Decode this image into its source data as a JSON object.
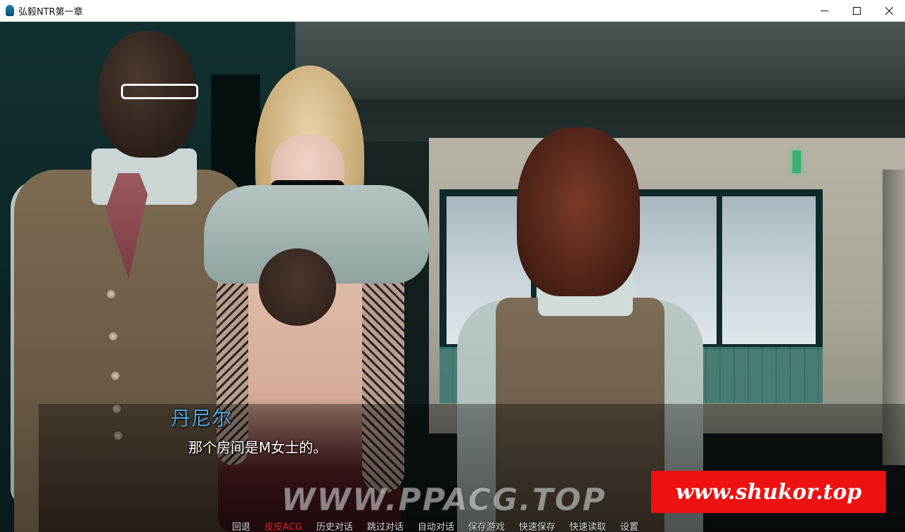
{
  "window": {
    "title": "弘毅NTR第一章",
    "controls": {
      "minimize_icon": "minimize-icon",
      "maximize_icon": "maximize-icon",
      "close_icon": "close-icon"
    }
  },
  "dialogue": {
    "speaker": "丹尼尔",
    "text": "那个房间是M女士的。",
    "speaker_color": "#4fa6dd"
  },
  "watermarks": {
    "center": "WWW.PPACG.TOP",
    "corner": "www.shukor.top",
    "corner_bg": "#ee1111"
  },
  "quick_menu": {
    "items": [
      {
        "label": "回退",
        "active": false
      },
      {
        "label": "皮皮ACG",
        "active": true
      },
      {
        "label": "历史对话",
        "active": false
      },
      {
        "label": "跳过对话",
        "active": false
      },
      {
        "label": "自动对话",
        "active": false
      },
      {
        "label": "保存游戏",
        "active": false
      },
      {
        "label": "快速保存",
        "active": false
      },
      {
        "label": "快速读取",
        "active": false
      },
      {
        "label": "设置",
        "active": false
      }
    ],
    "active_color": "#e8242c"
  }
}
